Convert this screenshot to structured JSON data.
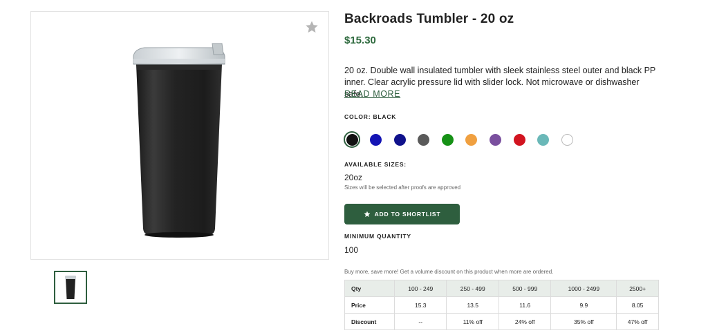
{
  "product": {
    "title": "Backroads Tumbler - 20 oz",
    "price": "$15.30",
    "description": "20 oz. Double wall insulated tumbler with sleek stainless steel outer and black PP inner. Clear acrylic pressure lid with slider lock. Not microwave or dishwasher safe.",
    "read_more": "READ MORE"
  },
  "colors": {
    "label": "COLOR: BLACK",
    "swatches": [
      "#111111",
      "#1414b4",
      "#10128c",
      "#5a5a5a",
      "#169116",
      "#f0a040",
      "#7a4f9e",
      "#d21420",
      "#6ab8b8",
      "#ffffff"
    ],
    "selected_index": 0
  },
  "sizes": {
    "label": "AVAILABLE SIZES:",
    "value": "20oz",
    "note": "Sizes will be selected after proofs are approved"
  },
  "shortlist_button": "ADD TO SHORTLIST",
  "minimum": {
    "label": "MINIMUM QUANTITY",
    "value": "100"
  },
  "discount_note": "Buy more, save more! Get a volume discount on this product when more are ordered.",
  "pricing_table": {
    "headers": [
      "Qty",
      "100 - 249",
      "250 - 499",
      "500 - 999",
      "1000 - 2499",
      "2500+"
    ],
    "price": [
      "Price",
      "15.3",
      "13.5",
      "11.6",
      "9.9",
      "8.05"
    ],
    "discount": [
      "Discount",
      "--",
      "11% off",
      "24% off",
      "35% off",
      "47% off"
    ]
  },
  "icons": {
    "favorite": "star-icon",
    "button": "star-icon"
  },
  "theme": {
    "accent": "#2e5e3e",
    "price_color": "#2e6a3e"
  }
}
